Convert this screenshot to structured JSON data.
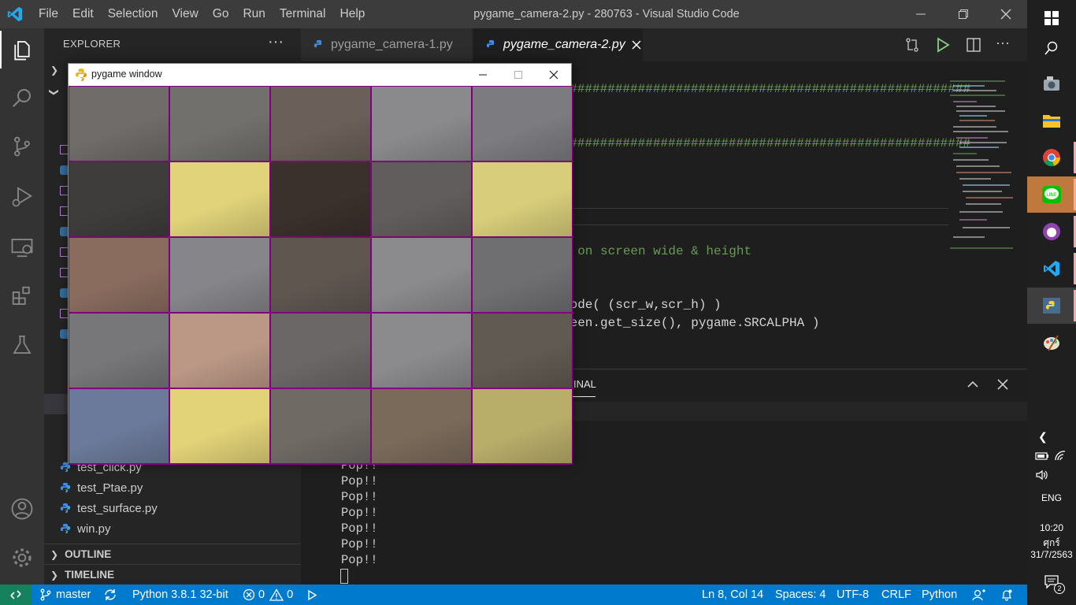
{
  "titlebar": {
    "menu": [
      "File",
      "Edit",
      "Selection",
      "View",
      "Go",
      "Run",
      "Terminal",
      "Help"
    ],
    "title": "pygame_camera-2.py - 280763 - Visual Studio Code"
  },
  "sidebar": {
    "header": "EXPLORER",
    "more": "···",
    "files": [
      "test_click.py",
      "test_Ptae.py",
      "test_surface.py",
      "win.py"
    ],
    "sections": [
      "OUTLINE",
      "TIMELINE"
    ]
  },
  "tabs": [
    {
      "label": "pygame_camera-1.py",
      "active": false
    },
    {
      "label": "pygame_camera-2.py",
      "active": true
    }
  ],
  "editor": {
    "lines": [
      {
        "text": "#######################################################",
        "kind": "comment"
      },
      {
        "text": "#######################################################",
        "kind": "comment"
      },
      {
        "text": "s on screen wide & height",
        "kind": "comment"
      },
      {
        "text": "mode( (scr_w,scr_h) )",
        "kind": "plain"
      },
      {
        "text": "reen.get_size(), pygame.SRCALPHA )",
        "kind": "plain"
      }
    ]
  },
  "panel": {
    "tab_label": "INAL",
    "terminal_lines": [
      "Pop!!",
      "Pop!!",
      "Pop!!",
      "Pop!!",
      "Pop!!",
      "Pop!!",
      "Pop!!"
    ]
  },
  "statusbar": {
    "branch": "master",
    "python": "Python 3.8.1 32-bit",
    "errors": "0",
    "warnings": "0",
    "position": "Ln 8, Col 14",
    "spaces": "Spaces: 4",
    "encoding": "UTF-8",
    "eol": "CRLF",
    "language": "Python"
  },
  "taskbar": {
    "lang": "ENG",
    "time": "10:20",
    "day": "ศุกร์",
    "date": "31/7/2563",
    "notifications": "2"
  },
  "pygame": {
    "title": "pygame window",
    "grid_rows": 5,
    "grid_cols": 5,
    "border_color": "#800080",
    "tile_colors": [
      "#6f6c69",
      "#72706d",
      "#6b6059",
      "#8a8a8c",
      "#7c7c80",
      "#3f3d3b",
      "#e0d37a",
      "#3a302c",
      "#615d5c",
      "#d8cd7a",
      "#8a6c5f",
      "#86868a",
      "#5f5650",
      "#8b8b8d",
      "#6f6f72",
      "#77777a",
      "#bb9886",
      "#6b6766",
      "#8b8a8c",
      "#615a52",
      "#6b7a9a",
      "#e2d278",
      "#6f6a64",
      "#7a6a5a",
      "#b9ad6a"
    ]
  }
}
